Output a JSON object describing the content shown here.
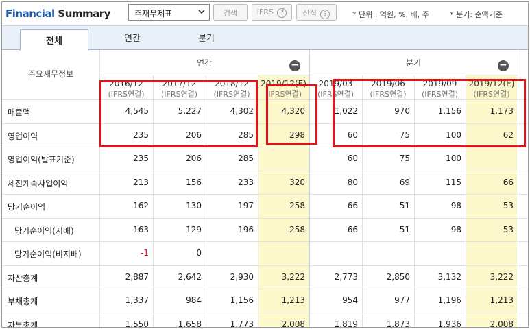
{
  "toolbar": {
    "brand_part1": "Financial",
    "brand_part2": " Summary",
    "select_value": "주재무제표",
    "search_label": "검색",
    "ifrs_label": "IFRS",
    "formula_label": "산식",
    "help_glyph": "?",
    "unit_note": "* 단위 : 억원, %, 배, 주",
    "quarter_note": "* 분기: 순액기준"
  },
  "tabs": [
    {
      "label": "전체",
      "active": true
    },
    {
      "label": "연간",
      "active": false
    },
    {
      "label": "분기",
      "active": false
    }
  ],
  "table": {
    "corner_label": "주요재무정보",
    "group_annual": "연간",
    "group_quarter": "분기",
    "collapse_glyph": "−",
    "columns": [
      {
        "period": "2016/12",
        "basis": "(IFRS연결)"
      },
      {
        "period": "2017/12",
        "basis": "(IFRS연결)"
      },
      {
        "period": "2018/12",
        "basis": "(IFRS연결)"
      },
      {
        "period": "2019/12(E)",
        "basis": "(IFRS연결)"
      },
      {
        "period": "2019/03",
        "basis": "(IFRS연결)"
      },
      {
        "period": "2019/06",
        "basis": "(IFRS연결)"
      },
      {
        "period": "2019/09",
        "basis": "(IFRS연결)"
      },
      {
        "period": "2019/12(E)",
        "basis": "(IFRS연결)"
      }
    ],
    "rows": [
      {
        "label": "매출액",
        "values": [
          "4,545",
          "5,227",
          "4,302",
          "4,320",
          "1,022",
          "970",
          "1,156",
          "1,173"
        ]
      },
      {
        "label": "영업이익",
        "values": [
          "235",
          "206",
          "285",
          "298",
          "60",
          "75",
          "100",
          "62"
        ]
      },
      {
        "label": "영업이익(발표기준)",
        "values": [
          "235",
          "206",
          "285",
          "",
          "60",
          "75",
          "100",
          ""
        ]
      },
      {
        "label": "세전계속사업이익",
        "values": [
          "213",
          "156",
          "233",
          "320",
          "80",
          "69",
          "115",
          "66"
        ]
      },
      {
        "label": "당기순이익",
        "values": [
          "162",
          "130",
          "197",
          "258",
          "66",
          "51",
          "98",
          "53"
        ]
      },
      {
        "label": "당기순이익(지배)",
        "values": [
          "163",
          "129",
          "196",
          "258",
          "66",
          "51",
          "98",
          "53"
        ]
      },
      {
        "label": "당기순이익(비지배)",
        "values": [
          "-1",
          "0",
          "",
          "",
          "",
          "",
          "",
          ""
        ]
      },
      {
        "label": "자산총계",
        "values": [
          "2,887",
          "2,642",
          "2,930",
          "3,222",
          "2,773",
          "2,850",
          "3,132",
          "3,222"
        ]
      },
      {
        "label": "부채총계",
        "values": [
          "1,337",
          "984",
          "1,156",
          "1,213",
          "954",
          "977",
          "1,196",
          "1,213"
        ]
      },
      {
        "label": "자본총계",
        "values": [
          "1,550",
          "1,658",
          "1,773",
          "2,008",
          "1,819",
          "1,873",
          "1,936",
          "2,008"
        ]
      }
    ]
  }
}
